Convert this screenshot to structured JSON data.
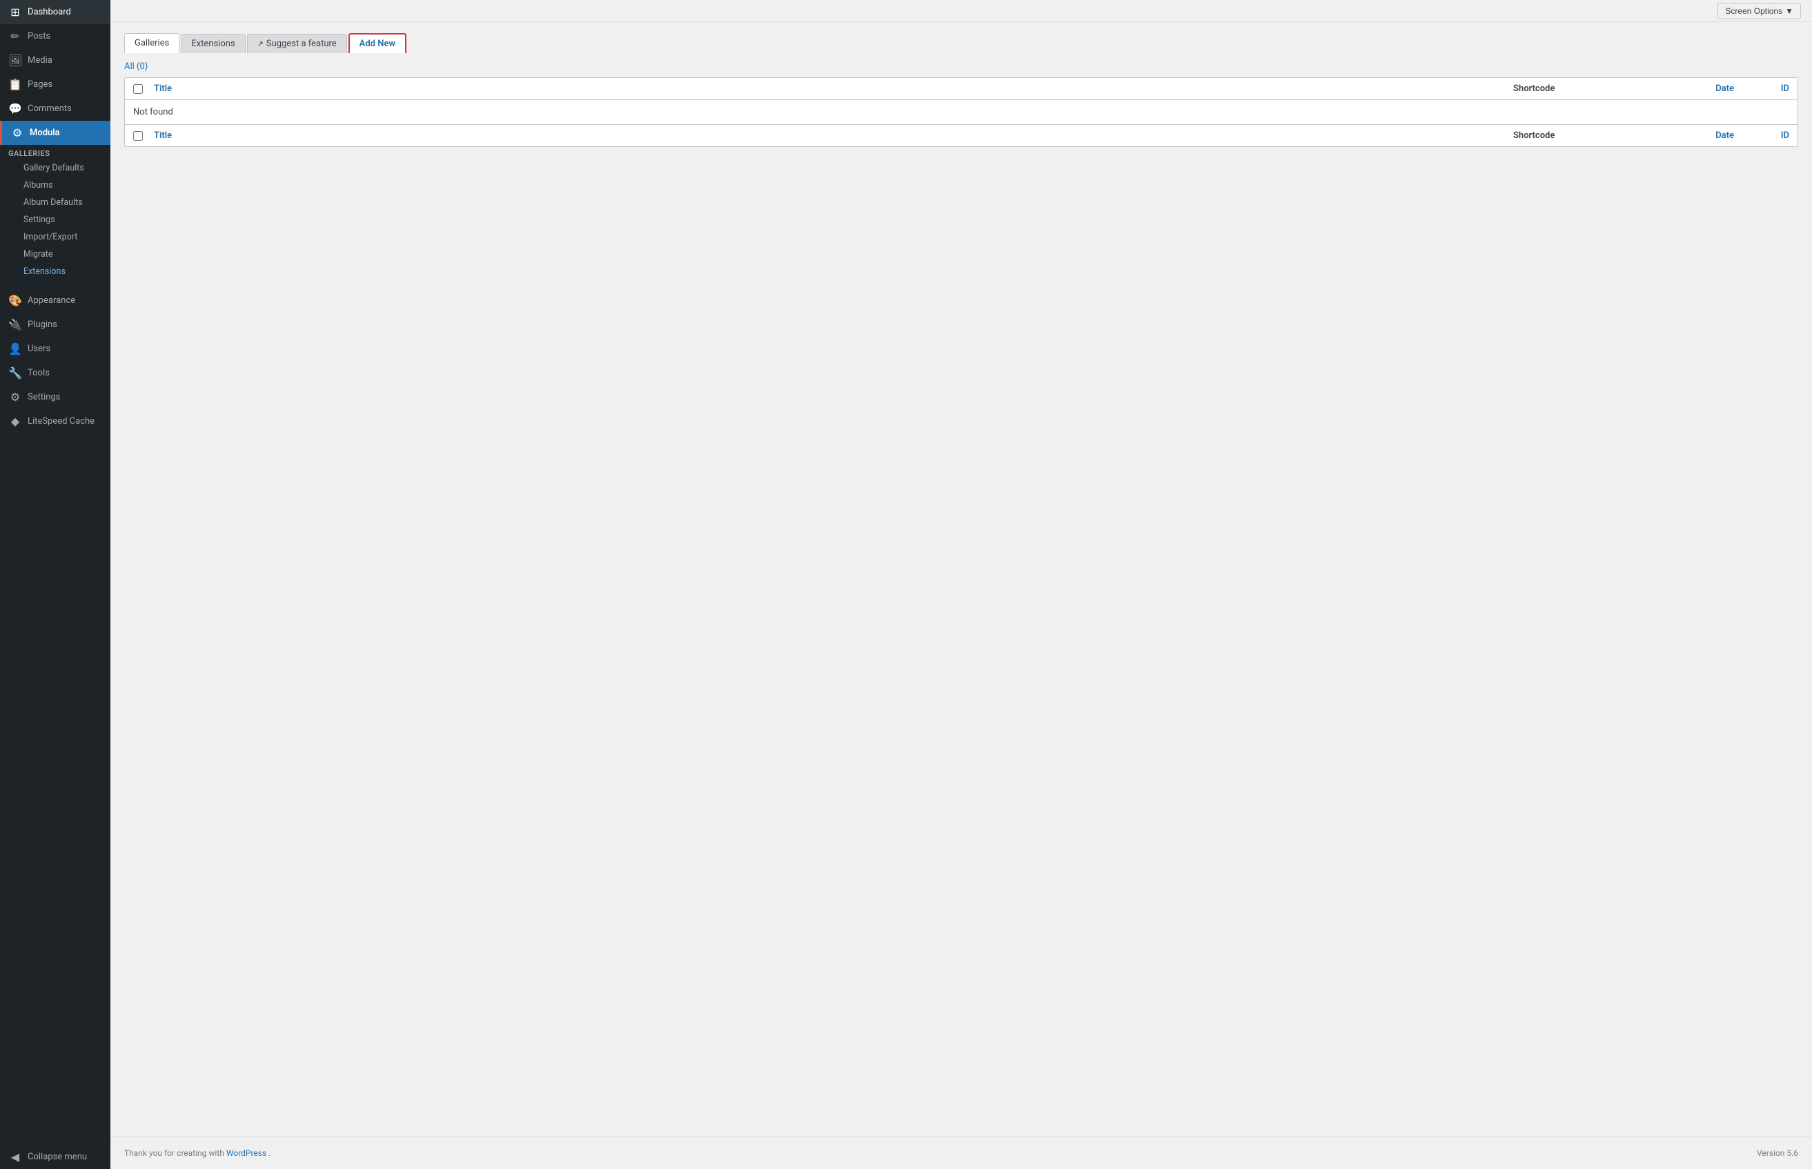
{
  "sidebar": {
    "items": [
      {
        "id": "dashboard",
        "label": "Dashboard",
        "icon": "⊞"
      },
      {
        "id": "posts",
        "label": "Posts",
        "icon": "📄"
      },
      {
        "id": "media",
        "label": "Media",
        "icon": "🖼"
      },
      {
        "id": "pages",
        "label": "Pages",
        "icon": "📋"
      },
      {
        "id": "comments",
        "label": "Comments",
        "icon": "💬"
      },
      {
        "id": "modula",
        "label": "Modula",
        "icon": "⚙"
      }
    ],
    "modula_submenu": {
      "section_label": "Galleries",
      "items": [
        {
          "id": "gallery-defaults",
          "label": "Gallery Defaults"
        },
        {
          "id": "albums",
          "label": "Albums"
        },
        {
          "id": "album-defaults",
          "label": "Album Defaults"
        },
        {
          "id": "settings",
          "label": "Settings"
        },
        {
          "id": "import-export",
          "label": "Import/Export"
        },
        {
          "id": "migrate",
          "label": "Migrate"
        },
        {
          "id": "extensions",
          "label": "Extensions",
          "active": true
        }
      ]
    },
    "bottom_items": [
      {
        "id": "appearance",
        "label": "Appearance",
        "icon": "🎨"
      },
      {
        "id": "plugins",
        "label": "Plugins",
        "icon": "🔌"
      },
      {
        "id": "users",
        "label": "Users",
        "icon": "👤"
      },
      {
        "id": "tools",
        "label": "Tools",
        "icon": "🔧"
      },
      {
        "id": "settings",
        "label": "Settings",
        "icon": "⚙"
      },
      {
        "id": "litespeed",
        "label": "LiteSpeed Cache",
        "icon": "◆"
      }
    ],
    "collapse_label": "Collapse menu"
  },
  "topbar": {
    "screen_options_label": "Screen Options",
    "screen_options_arrow": "▼"
  },
  "tabs": [
    {
      "id": "galleries",
      "label": "Galleries",
      "active": true
    },
    {
      "id": "extensions",
      "label": "Extensions"
    },
    {
      "id": "suggest",
      "label": "Suggest a feature",
      "has_icon": true
    },
    {
      "id": "add-new",
      "label": "Add New",
      "highlighted": true
    }
  ],
  "filter_bar": {
    "all_label": "All",
    "count": "(0)"
  },
  "table": {
    "header": {
      "checkbox_col": "",
      "title_col": "Title",
      "shortcode_col": "Shortcode",
      "date_col": "Date",
      "id_col": "ID"
    },
    "not_found_text": "Not found",
    "footer": {
      "checkbox_col": "",
      "title_col": "Title",
      "shortcode_col": "Shortcode",
      "date_col": "Date",
      "id_col": "ID"
    }
  },
  "footer": {
    "thank_you_text": "Thank you for creating with",
    "wordpress_link": "WordPress",
    "version_text": "Version 5.6"
  }
}
